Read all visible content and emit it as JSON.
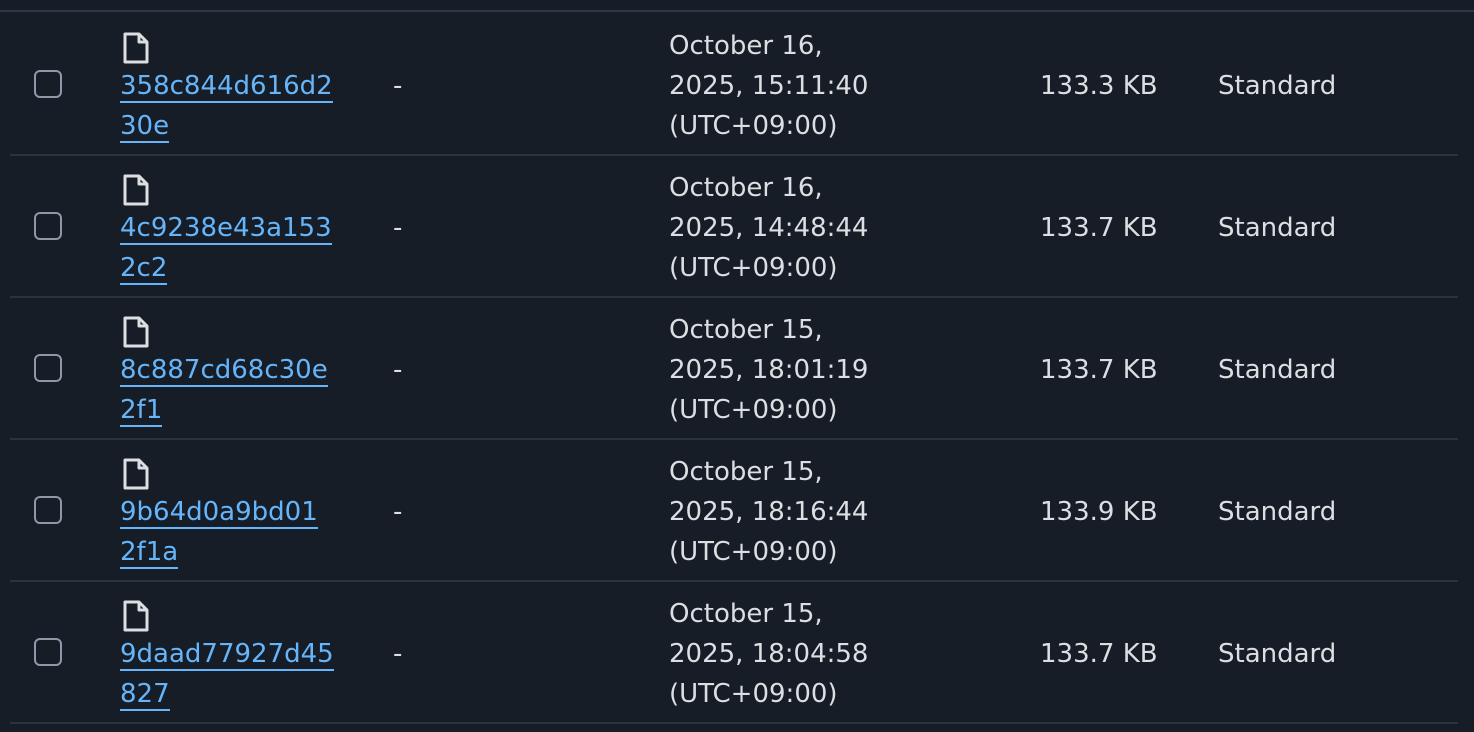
{
  "colors": {
    "background": "#161d26",
    "link": "#66b5fa",
    "text": "#dcdee2",
    "divider": "#2a323d",
    "checkbox_border": "#8d99a8"
  },
  "rows": [
    {
      "icon": "file-icon",
      "name_line1": "358c844d616d2",
      "name_line2": "30e",
      "description": "-",
      "modified_line1": "October 16,",
      "modified_line2": "2025, 15:11:40",
      "modified_line3": "(UTC+09:00)",
      "size": "133.3 KB",
      "storage_class": "Standard"
    },
    {
      "icon": "file-icon",
      "name_line1": "4c9238e43a153",
      "name_line2": "2c2",
      "description": "-",
      "modified_line1": "October 16,",
      "modified_line2": "2025, 14:48:44",
      "modified_line3": "(UTC+09:00)",
      "size": "133.7 KB",
      "storage_class": "Standard"
    },
    {
      "icon": "file-icon",
      "name_line1": "8c887cd68c30e",
      "name_line2": "2f1",
      "description": "-",
      "modified_line1": "October 15,",
      "modified_line2": "2025, 18:01:19",
      "modified_line3": "(UTC+09:00)",
      "size": "133.7 KB",
      "storage_class": "Standard"
    },
    {
      "icon": "file-icon",
      "name_line1": "9b64d0a9bd01",
      "name_line2": "2f1a",
      "description": "-",
      "modified_line1": "October 15,",
      "modified_line2": "2025, 18:16:44",
      "modified_line3": "(UTC+09:00)",
      "size": "133.9 KB",
      "storage_class": "Standard"
    },
    {
      "icon": "file-icon",
      "name_line1": "9daad77927d45",
      "name_line2": "827",
      "description": "-",
      "modified_line1": "October 15,",
      "modified_line2": "2025, 18:04:58",
      "modified_line3": "(UTC+09:00)",
      "size": "133.7 KB",
      "storage_class": "Standard"
    }
  ]
}
